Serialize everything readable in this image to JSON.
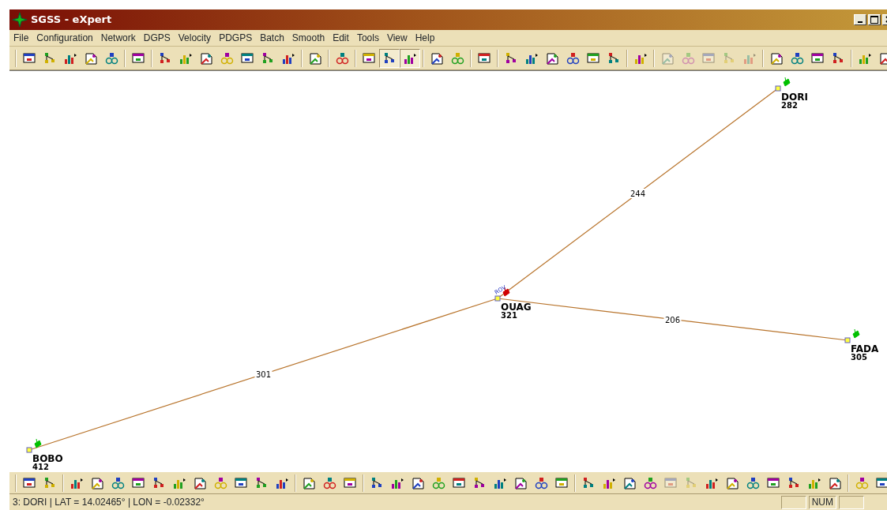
{
  "window": {
    "title": "SGSS - eXpert"
  },
  "menu": [
    "File",
    "Configuration",
    "Network",
    "DGPS",
    "Velocity",
    "PDGPS",
    "Batch",
    "Smooth",
    "Edit",
    "Tools",
    "View",
    "Help"
  ],
  "toolbar": [
    [
      {
        "disabled": false,
        "pressed": false
      },
      {
        "disabled": false,
        "pressed": false
      },
      {
        "disabled": false,
        "pressed": false
      },
      {
        "disabled": false,
        "pressed": false
      },
      {
        "disabled": false,
        "pressed": false
      }
    ],
    [
      {
        "disabled": false,
        "pressed": false
      }
    ],
    [
      {
        "disabled": false,
        "pressed": false
      },
      {
        "disabled": false,
        "pressed": false
      },
      {
        "disabled": false,
        "pressed": false
      },
      {
        "disabled": false,
        "pressed": false
      },
      {
        "disabled": false,
        "pressed": false
      },
      {
        "disabled": false,
        "pressed": false
      },
      {
        "disabled": false,
        "pressed": false
      }
    ],
    [
      {
        "disabled": false,
        "pressed": false
      }
    ],
    [
      {
        "disabled": false,
        "pressed": false
      }
    ],
    [
      {
        "disabled": false,
        "pressed": false
      },
      {
        "disabled": false,
        "pressed": true
      },
      {
        "disabled": false,
        "pressed": true
      }
    ],
    [
      {
        "disabled": false,
        "pressed": false
      },
      {
        "disabled": false,
        "pressed": false
      }
    ],
    [
      {
        "disabled": false,
        "pressed": false
      }
    ],
    [
      {
        "disabled": false,
        "pressed": false
      },
      {
        "disabled": false,
        "pressed": false
      },
      {
        "disabled": false,
        "pressed": false
      },
      {
        "disabled": false,
        "pressed": false
      },
      {
        "disabled": false,
        "pressed": false
      },
      {
        "disabled": false,
        "pressed": false
      }
    ],
    [
      {
        "disabled": false,
        "pressed": false
      }
    ],
    [
      {
        "disabled": true,
        "pressed": false
      },
      {
        "disabled": true,
        "pressed": false
      },
      {
        "disabled": true,
        "pressed": false
      },
      {
        "disabled": true,
        "pressed": false
      },
      {
        "disabled": true,
        "pressed": false
      }
    ],
    [
      {
        "disabled": false,
        "pressed": false
      },
      {
        "disabled": false,
        "pressed": false
      },
      {
        "disabled": false,
        "pressed": false
      },
      {
        "disabled": false,
        "pressed": false
      }
    ],
    [
      {
        "disabled": false,
        "pressed": false
      },
      {
        "disabled": false,
        "pressed": false
      }
    ]
  ],
  "network": {
    "stations": [
      {
        "name": "DORI",
        "count": "282",
        "color": "#00c000"
      },
      {
        "name": "OUAG",
        "count": "321",
        "color": "#d00000",
        "tag": "ROV"
      },
      {
        "name": "FADA",
        "count": "305",
        "color": "#00c000"
      },
      {
        "name": "BOBO",
        "count": "412",
        "color": "#00c000"
      }
    ],
    "baselines": [
      {
        "label": "244"
      },
      {
        "label": "206"
      },
      {
        "label": "301"
      }
    ]
  },
  "bottom_toolbar": [
    [
      {
        "disabled": false
      },
      {
        "disabled": false
      }
    ],
    [
      {
        "disabled": false
      },
      {
        "disabled": false
      },
      {
        "disabled": false
      },
      {
        "disabled": false
      },
      {
        "disabled": false
      },
      {
        "disabled": false
      },
      {
        "disabled": false
      },
      {
        "disabled": false
      },
      {
        "disabled": false
      },
      {
        "disabled": false
      },
      {
        "disabled": false
      }
    ],
    [
      {
        "disabled": false
      },
      {
        "disabled": false
      },
      {
        "disabled": false
      }
    ],
    [
      {
        "disabled": false
      },
      {
        "disabled": false
      },
      {
        "disabled": false
      },
      {
        "disabled": false
      },
      {
        "disabled": false
      },
      {
        "disabled": false
      },
      {
        "disabled": false
      },
      {
        "disabled": false
      },
      {
        "disabled": false
      },
      {
        "disabled": false
      }
    ],
    [
      {
        "disabled": false
      },
      {
        "disabled": false
      },
      {
        "disabled": false
      },
      {
        "disabled": false
      },
      {
        "disabled": true
      },
      {
        "disabled": true
      },
      {
        "disabled": false
      },
      {
        "disabled": false
      },
      {
        "disabled": false
      },
      {
        "disabled": false
      },
      {
        "disabled": false
      },
      {
        "disabled": false
      },
      {
        "disabled": false
      }
    ],
    [
      {
        "disabled": false
      },
      {
        "disabled": false
      }
    ]
  ],
  "status_bar": {
    "text": "3: DORI | LAT = 14.02465° | LON = -0.02332°",
    "panes": [
      {
        "kind": "blank"
      },
      {
        "kind": "text",
        "text": "NUM"
      },
      {
        "kind": "blank"
      }
    ]
  }
}
